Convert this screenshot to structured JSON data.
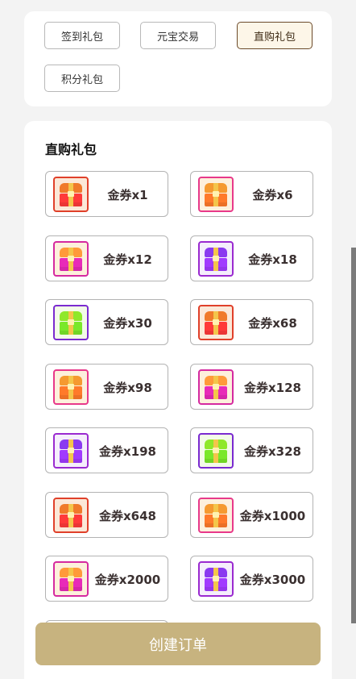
{
  "tabs": [
    {
      "label": "签到礼包",
      "active": false
    },
    {
      "label": "元宝交易",
      "active": false
    },
    {
      "label": "直购礼包",
      "active": true
    },
    {
      "label": "积分礼包",
      "active": false
    }
  ],
  "section": {
    "title": "直购礼包"
  },
  "packages": [
    {
      "label": "金券x1",
      "icon": "chest-red-icon"
    },
    {
      "label": "金券x6",
      "icon": "chest-orange-icon"
    },
    {
      "label": "金券x12",
      "icon": "chest-pink-icon"
    },
    {
      "label": "金券x18",
      "icon": "chest-purple-icon"
    },
    {
      "label": "金券x30",
      "icon": "chest-green-icon"
    },
    {
      "label": "金券x68",
      "icon": "chest-red-icon"
    },
    {
      "label": "金券x98",
      "icon": "chest-orange-icon"
    },
    {
      "label": "金券x128",
      "icon": "chest-pink-icon"
    },
    {
      "label": "金券x198",
      "icon": "chest-purple-icon"
    },
    {
      "label": "金券x328",
      "icon": "chest-green-icon"
    },
    {
      "label": "金券x648",
      "icon": "chest-red-icon"
    },
    {
      "label": "金券x1000",
      "icon": "chest-orange-icon"
    },
    {
      "label": "金券x2000",
      "icon": "chest-pink-icon"
    },
    {
      "label": "金券x3000",
      "icon": "chest-purple-icon"
    }
  ],
  "footer": {
    "create_order_label": "创建订单"
  },
  "colors": {
    "accent_button": "#c7b37f",
    "active_tab_border": "#6b4a2a",
    "active_tab_bg": "#fdf6e8"
  }
}
